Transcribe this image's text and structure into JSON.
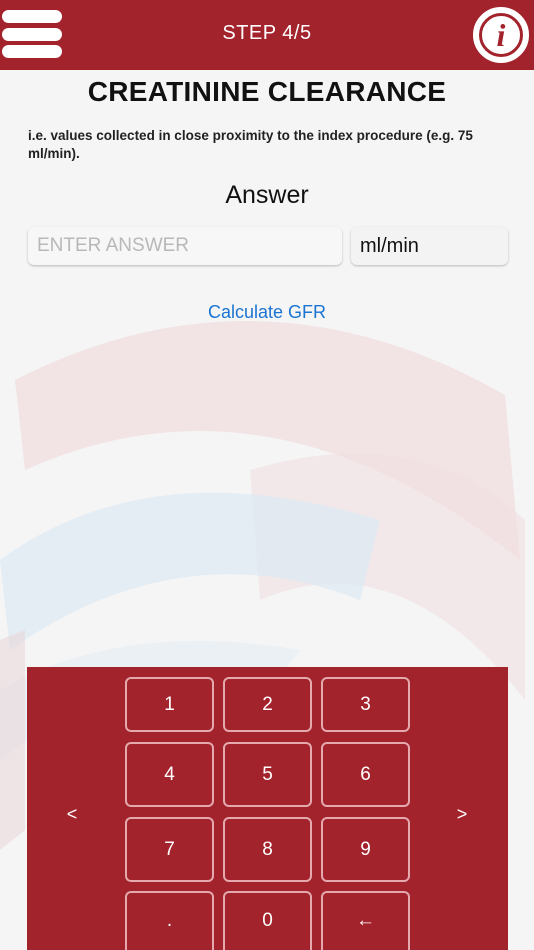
{
  "header": {
    "step": "STEP 4/5",
    "info_glyph": "i"
  },
  "title": "CREATININE CLEARANCE",
  "hint": "i.e. values collected in close proximity to the index procedure (e.g. 75 ml/min).",
  "answer": {
    "label": "Answer",
    "placeholder": "ENTER ANSWER",
    "value": "",
    "unit": "ml/min"
  },
  "calc_link": "Calculate GFR",
  "keypad": {
    "keys": [
      {
        "label": "1",
        "name": "key-1"
      },
      {
        "label": "2",
        "name": "key-2"
      },
      {
        "label": "3",
        "name": "key-3"
      },
      {
        "label": "4",
        "name": "key-4"
      },
      {
        "label": "5",
        "name": "key-5"
      },
      {
        "label": "6",
        "name": "key-6"
      },
      {
        "label": "7",
        "name": "key-7"
      },
      {
        "label": "8",
        "name": "key-8"
      },
      {
        "label": "9",
        "name": "key-9"
      },
      {
        "label": ".",
        "name": "key-decimal"
      },
      {
        "label": "0",
        "name": "key-0"
      },
      {
        "label": "←",
        "name": "key-backspace"
      }
    ],
    "prev": "<",
    "next": ">"
  },
  "colors": {
    "brand": "#a3232d",
    "link": "#1a74d1",
    "key_border": "#e3a9ad",
    "watermark_red": "#efd9da",
    "watermark_blue": "#dde9f1"
  }
}
